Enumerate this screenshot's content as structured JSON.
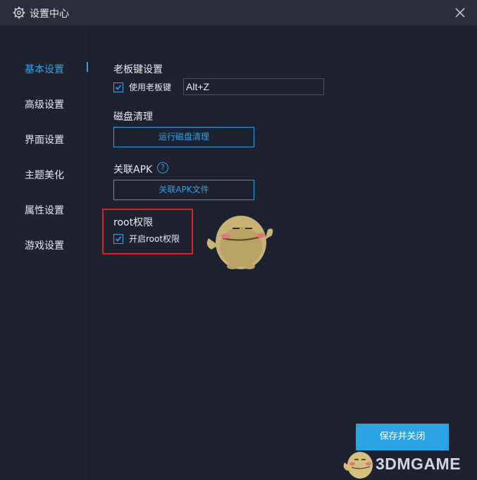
{
  "window": {
    "title": "设置中心"
  },
  "sidebar": {
    "items": [
      {
        "label": "基本设置",
        "active": true
      },
      {
        "label": "高级设置",
        "active": false
      },
      {
        "label": "界面设置",
        "active": false
      },
      {
        "label": "主题美化",
        "active": false
      },
      {
        "label": "属性设置",
        "active": false
      },
      {
        "label": "游戏设置",
        "active": false
      }
    ]
  },
  "boss_key": {
    "title": "老板键设置",
    "checkbox_label": "使用老板键",
    "checked": true,
    "hotkey_value": "Alt+Z"
  },
  "disk": {
    "title": "磁盘清理",
    "button_label": "运行磁盘清理"
  },
  "apk": {
    "title": "关联APK",
    "help": "?",
    "button_label": "关联APK文件"
  },
  "root": {
    "title": "root权限",
    "checkbox_label": "开启root权限",
    "checked": true
  },
  "footer": {
    "save_label": "保存并关闭"
  },
  "watermark": {
    "text": "3DMGAME"
  },
  "icons": {
    "title": "gear-icon",
    "close": "close-icon",
    "help": "question-icon",
    "check": "check-icon"
  },
  "colors": {
    "accent": "#2fa3e6",
    "highlight": "#e02020",
    "background": "#1e2230",
    "titlebar": "#2a2f3b"
  }
}
